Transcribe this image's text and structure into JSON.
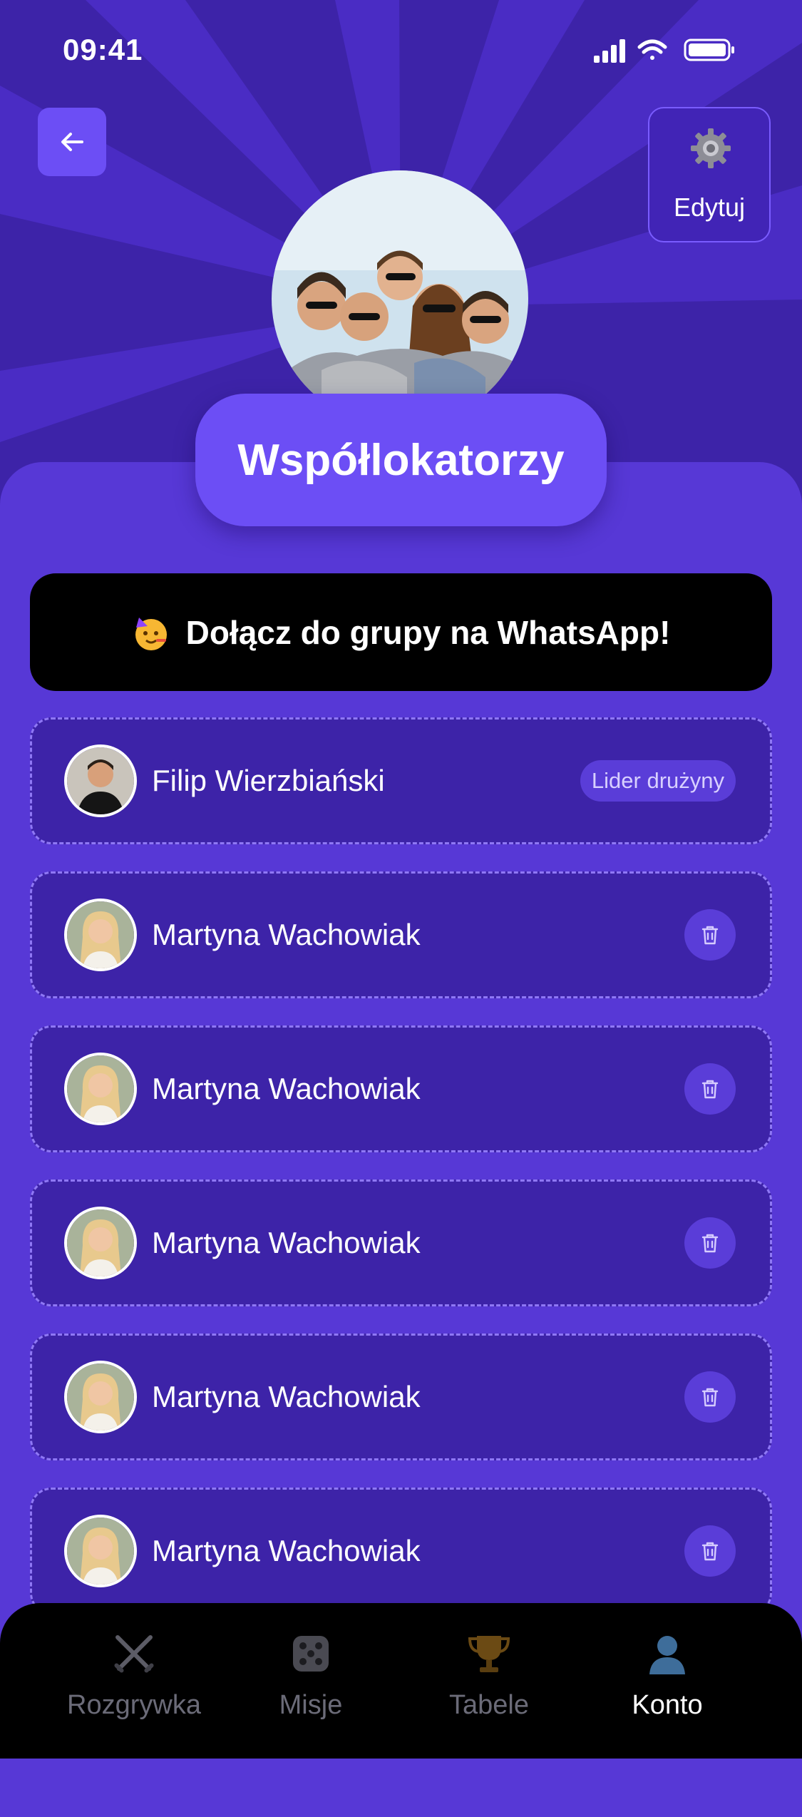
{
  "status_bar": {
    "time": "09:41"
  },
  "header": {
    "edit_label": "Edytuj"
  },
  "group": {
    "name": "Współlokatorzy"
  },
  "whatsapp_banner": {
    "text": "Dołącz do grupy na WhatsApp!"
  },
  "members": [
    {
      "name": "Filip Wierzbiański",
      "badge": "Lider drużyny",
      "action": "badge"
    },
    {
      "name": "Martyna Wachowiak",
      "action": "trash-icon"
    },
    {
      "name": "Martyna Wachowiak",
      "action": "trash-icon"
    },
    {
      "name": "Martyna Wachowiak",
      "action": "trash-icon"
    },
    {
      "name": "Martyna Wachowiak",
      "action": "trash-icon"
    },
    {
      "name": "Martyna Wachowiak",
      "action": "trash-icon"
    }
  ],
  "tabbar": {
    "tabs": [
      {
        "label": "Rozgrywka",
        "icon": "crossed-swords-icon"
      },
      {
        "label": "Misje",
        "icon": "dice-icon"
      },
      {
        "label": "Tabele",
        "icon": "trophy-icon"
      },
      {
        "label": "Konto",
        "icon": "user-icon",
        "active": true
      }
    ]
  },
  "colors": {
    "background": "#3d23a8",
    "panel": "#5738d6",
    "accent": "#6c4ef5",
    "banner": "#000000",
    "tabbar": "#000000"
  }
}
